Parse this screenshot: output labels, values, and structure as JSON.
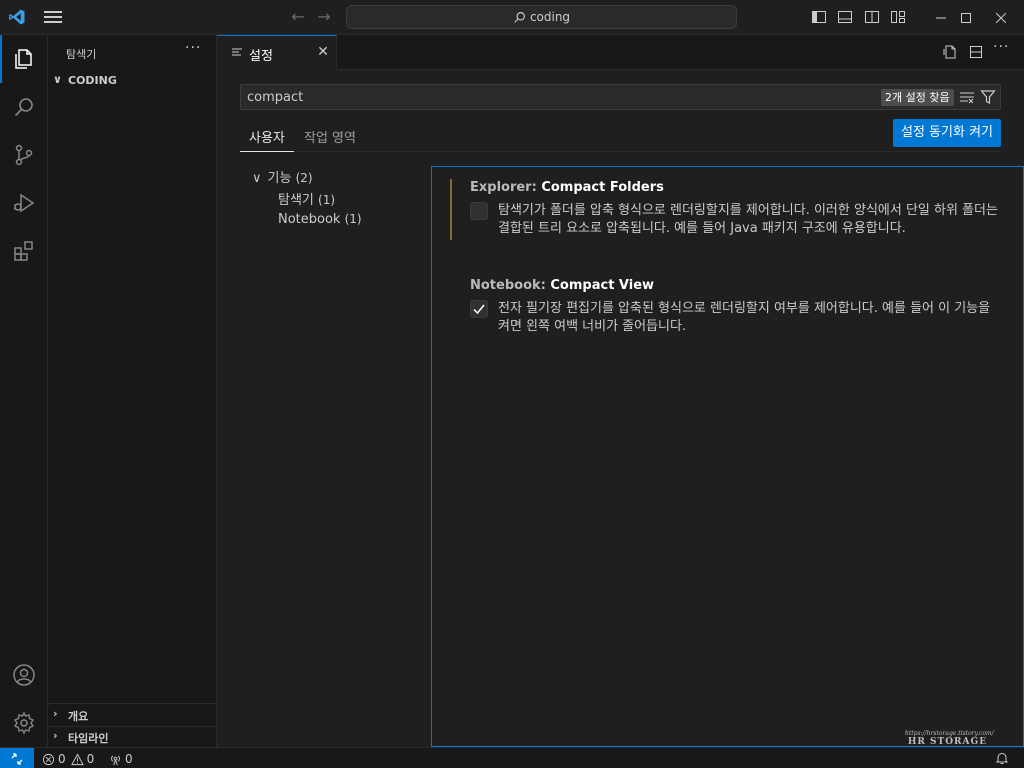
{
  "titlebar": {
    "search_text": "coding",
    "menu_icon": "hamburger-icon",
    "logo_icon": "vscode-logo-icon"
  },
  "activitybar": {
    "items": [
      "explorer-icon",
      "search-icon",
      "source-control-icon",
      "run-debug-icon",
      "extensions-icon"
    ],
    "bottom": [
      "account-icon",
      "manage-gear-icon"
    ],
    "accent": "#0078d4"
  },
  "sidebar": {
    "title": "탐색기",
    "more": "···",
    "root_folder": "CODING",
    "outline": "개요",
    "timeline": "타임라인"
  },
  "editor": {
    "tab_label": "설정",
    "search_value": "compact",
    "found_badge": "2개 설정 찾음",
    "scope_user": "사용자",
    "scope_workspace": "작업 영역",
    "sync_button": "설정 동기화 켜기",
    "toc": {
      "features": "기능",
      "features_count": "(2)",
      "explorer": "탐색기",
      "explorer_count": "(1)",
      "notebook": "Notebook",
      "notebook_count": "(1)"
    },
    "settings": [
      {
        "category": "Explorer: ",
        "name": "Compact Folders",
        "checked": false,
        "description": "탐색기가 폴더를 압축 형식으로 렌더링할지를 제어합니다. 이러한 양식에서 단일 하위 폴더는 결합된 트리 요소로 압축됩니다. 예를 들어 Java 패키지 구조에 유용합니다."
      },
      {
        "category": "Notebook: ",
        "name": "Compact View",
        "checked": true,
        "description": "전자 필기장 편집기를 압축된 형식으로 렌더링할지 여부를 제어합니다. 예를 들어 이 기능을 켜면 왼쪽 여백 너비가 줄어듭니다."
      }
    ]
  },
  "statusbar": {
    "errors": "0",
    "warnings": "0",
    "ports": "0"
  },
  "watermark": {
    "url": "https://hrstorage.tistory.com/",
    "brand": "HR STORAGE"
  }
}
